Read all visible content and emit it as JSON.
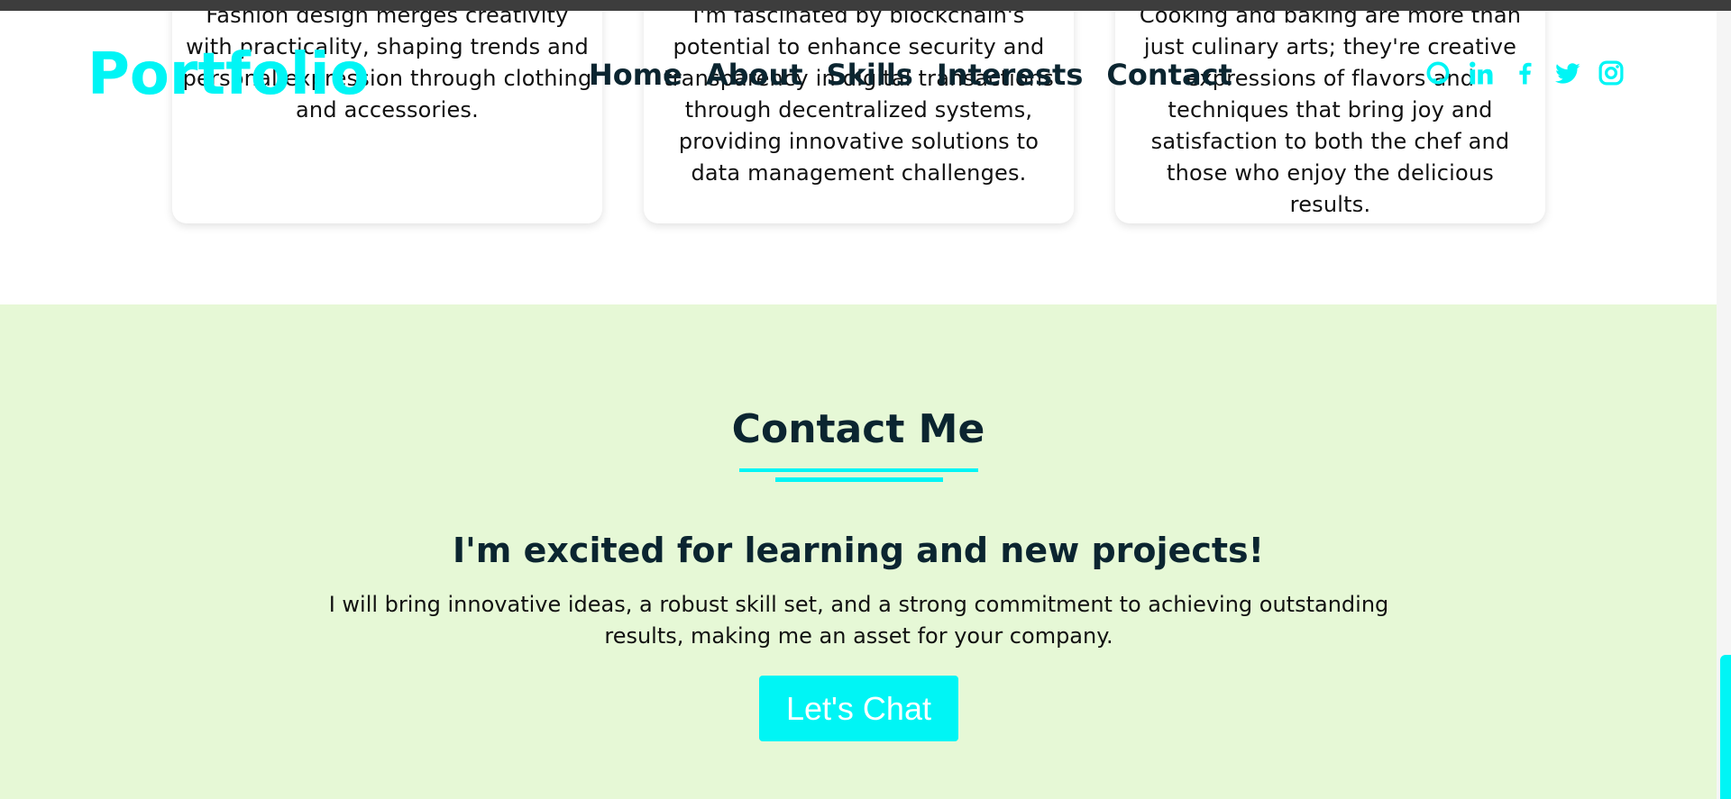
{
  "header": {
    "logo": "Portfolio",
    "nav": [
      "Home",
      "About",
      "Skills",
      "Interests",
      "Contact"
    ],
    "socials": [
      "github-icon",
      "linkedin-icon",
      "facebook-icon",
      "twitter-icon",
      "instagram-icon"
    ]
  },
  "interests": {
    "cards": [
      {
        "lines": [
          "Fashion design merges creativity",
          "with practicality, shaping trends and",
          "personal expression through clothing",
          "and accessories."
        ]
      },
      {
        "lines": [
          "I'm fascinated by blockchain's",
          "potential to enhance security and",
          "transparency in digital transactions",
          "through decentralized systems,",
          "providing innovative solutions to",
          "data management challenges."
        ]
      },
      {
        "lines": [
          "Cooking and baking are more than",
          "just culinary arts; they're creative",
          "expressions of flavors and",
          "techniques that bring joy and",
          "satisfaction to both the chef and",
          "those who enjoy the delicious results."
        ]
      }
    ]
  },
  "contact": {
    "title": "Contact Me",
    "subtitle": "I'm excited for learning and new projects!",
    "text_lines": [
      "I will bring innovative ideas, a robust skill set, and a strong commitment to achieving outstanding",
      "results, making me an asset for your company."
    ],
    "button_label": "Let's Chat"
  },
  "colors": {
    "accent": "#00f5f5",
    "contact_bg": "#e6f8d6",
    "heading": "#0b2530"
  }
}
